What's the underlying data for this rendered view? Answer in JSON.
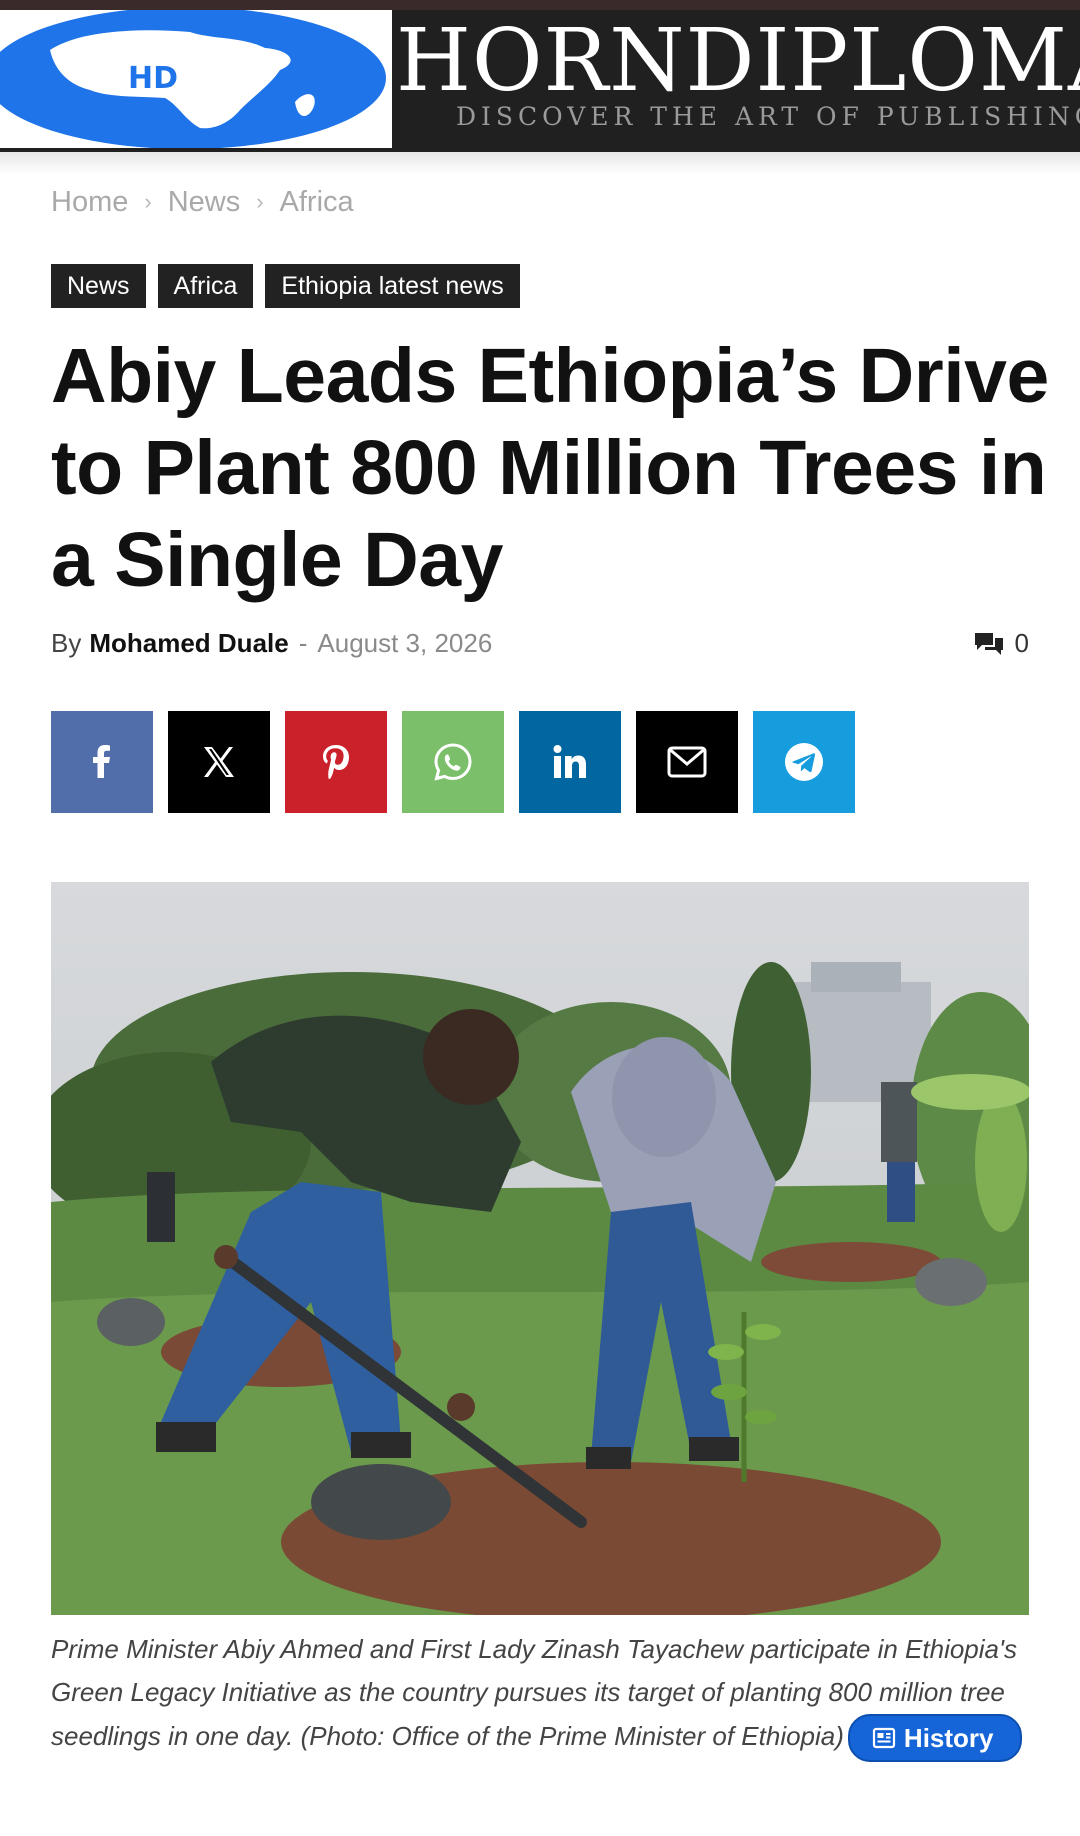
{
  "header": {
    "logo_text": "HD",
    "brand": "HORNDIPLOMA",
    "tagline": "DISCOVER THE ART OF PUBLISHING"
  },
  "breadcrumb": [
    "Home",
    "News",
    "Africa"
  ],
  "tags": [
    "News",
    "Africa",
    "Ethiopia latest news"
  ],
  "article": {
    "title": "Abiy Leads Ethiopia’s Drive to Plant 800 Million Trees in a Single Day",
    "by_label": "By",
    "author": "Mohamed Duale",
    "separator": "-",
    "date": "August 3, 2026",
    "comment_count": "0"
  },
  "share_buttons": [
    {
      "network": "facebook",
      "icon": "facebook-icon",
      "color": "#516eab"
    },
    {
      "network": "x",
      "icon": "x-icon",
      "color": "#000000"
    },
    {
      "network": "pinterest",
      "icon": "pinterest-icon",
      "color": "#ca212a"
    },
    {
      "network": "whatsapp",
      "icon": "whatsapp-icon",
      "color": "#7bbf6a"
    },
    {
      "network": "linkedin",
      "icon": "linkedin-icon",
      "color": "#0266a0"
    },
    {
      "network": "email",
      "icon": "mail-icon",
      "color": "#000000"
    },
    {
      "network": "telegram",
      "icon": "telegram-icon",
      "color": "#179cde"
    }
  ],
  "photo": {
    "caption": "Prime Minister Abiy Ahmed and First Lady Zinash Tayachew participate in Ethiopia's Green Legacy Initiative as the country pursues its target of planting 800 million tree seedlings in one day. (Photo: Office of the Prime Minister of Ethiopia)"
  },
  "history_pill": {
    "label": "History",
    "icon": "newspaper-icon",
    "color": "#1565d8"
  }
}
